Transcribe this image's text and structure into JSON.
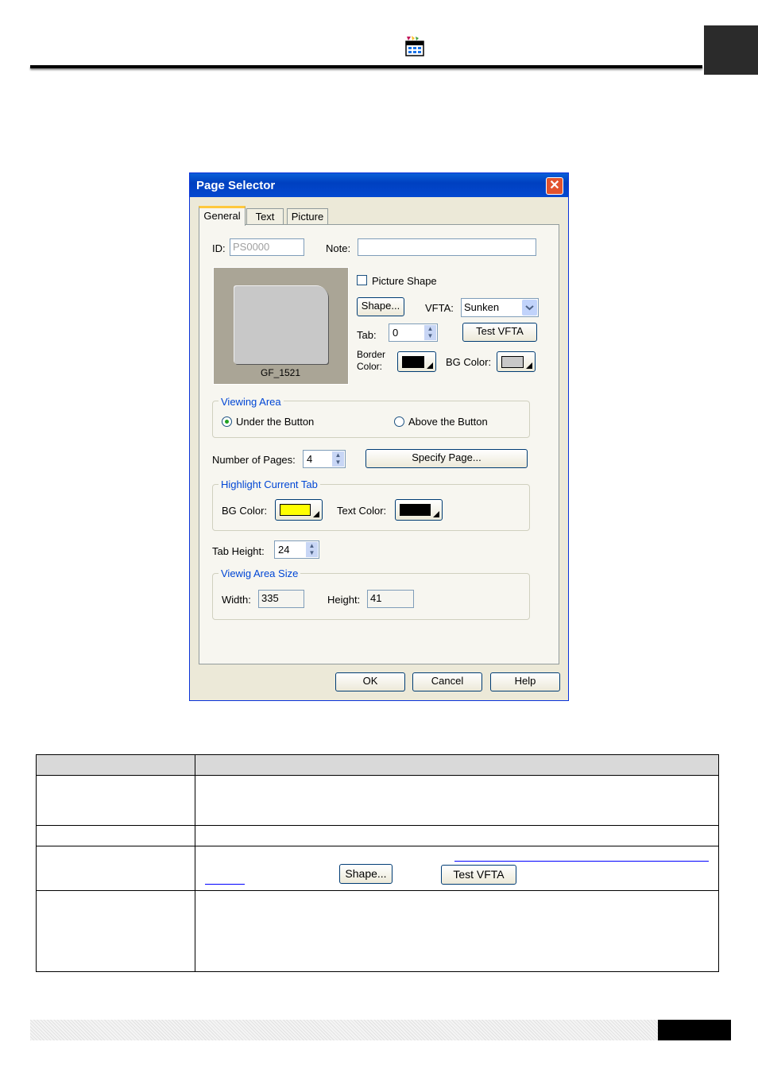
{
  "dialog": {
    "title": "Page Selector",
    "close_glyph": "✕",
    "tabs": [
      "General",
      "Text",
      "Picture"
    ],
    "id_label": "ID:",
    "id_value": "PS0000",
    "note_label": "Note:",
    "note_value": "",
    "preview_caption": "GF_1521",
    "picture_shape_label": "Picture Shape",
    "shape_button": "Shape...",
    "vfta_label": "VFTA:",
    "vfta_value": "Sunken",
    "tab_label": "Tab:",
    "tab_value": "0",
    "test_vfta_button": "Test VFTA",
    "border_color_label_1": "Border",
    "border_color_label_2": "Color:",
    "bg_color_label": "BG Color:",
    "viewing_area": {
      "title": "Viewing Area",
      "under_label": "Under the Button",
      "above_label": "Above the Button"
    },
    "pages_label": "Number of Pages:",
    "pages_value": "4",
    "specify_page_button": "Specify Page...",
    "highlight": {
      "title": "Highlight Current Tab",
      "bg_label": "BG Color:",
      "text_label": "Text Color:"
    },
    "tab_height_label": "Tab Height:",
    "tab_height_value": "24",
    "viewing_size": {
      "title": "Viewig Area Size",
      "width_label": "Width:",
      "width_value": "335",
      "height_label": "Height:",
      "height_value": "41"
    },
    "ok_button": "OK",
    "cancel_button": "Cancel",
    "help_button": "Help"
  },
  "table": {
    "shape_button": "Shape...",
    "test_vfta_button": "Test VFTA"
  },
  "colors": {
    "border_color": "#000000",
    "bg_color": "#c8c8c8",
    "highlight_bg": "#ffff00",
    "highlight_text": "#000000",
    "title_bar": "#0a5fd8"
  }
}
